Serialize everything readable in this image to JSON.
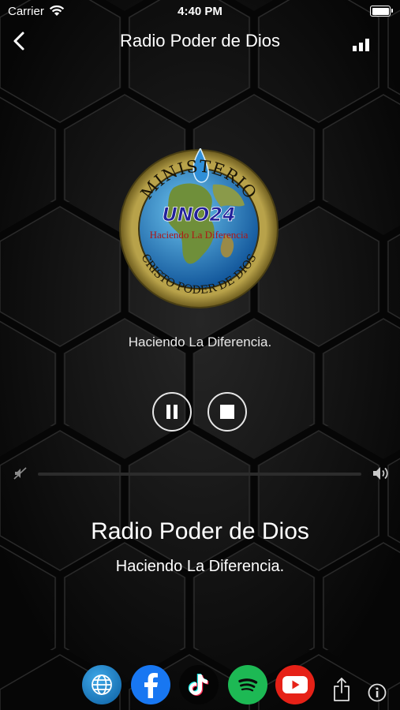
{
  "status_bar": {
    "carrier": "Carrier",
    "time": "4:40 PM"
  },
  "nav": {
    "title": "Radio Poder de Dios"
  },
  "logo": {
    "arc_top": "MINISTERIO",
    "brand": "UNO24",
    "slogan": "Haciendo La Diferencia",
    "arc_bottom": "CRISTO PODER DE DIOS"
  },
  "now_playing": {
    "subtitle": "Haciendo La Diferencia."
  },
  "player": {
    "volume_level": 0
  },
  "station": {
    "name": "Radio Poder de Dios",
    "tagline": "Haciendo La Diferencia."
  },
  "social": [
    "website-icon",
    "facebook-icon",
    "tiktok-icon",
    "spotify-icon",
    "youtube-icon"
  ],
  "colors": {
    "background": "#0c0c0c",
    "text": "#ffffff",
    "facebook": "#1877f2",
    "spotify": "#1db954",
    "youtube": "#e62117"
  }
}
